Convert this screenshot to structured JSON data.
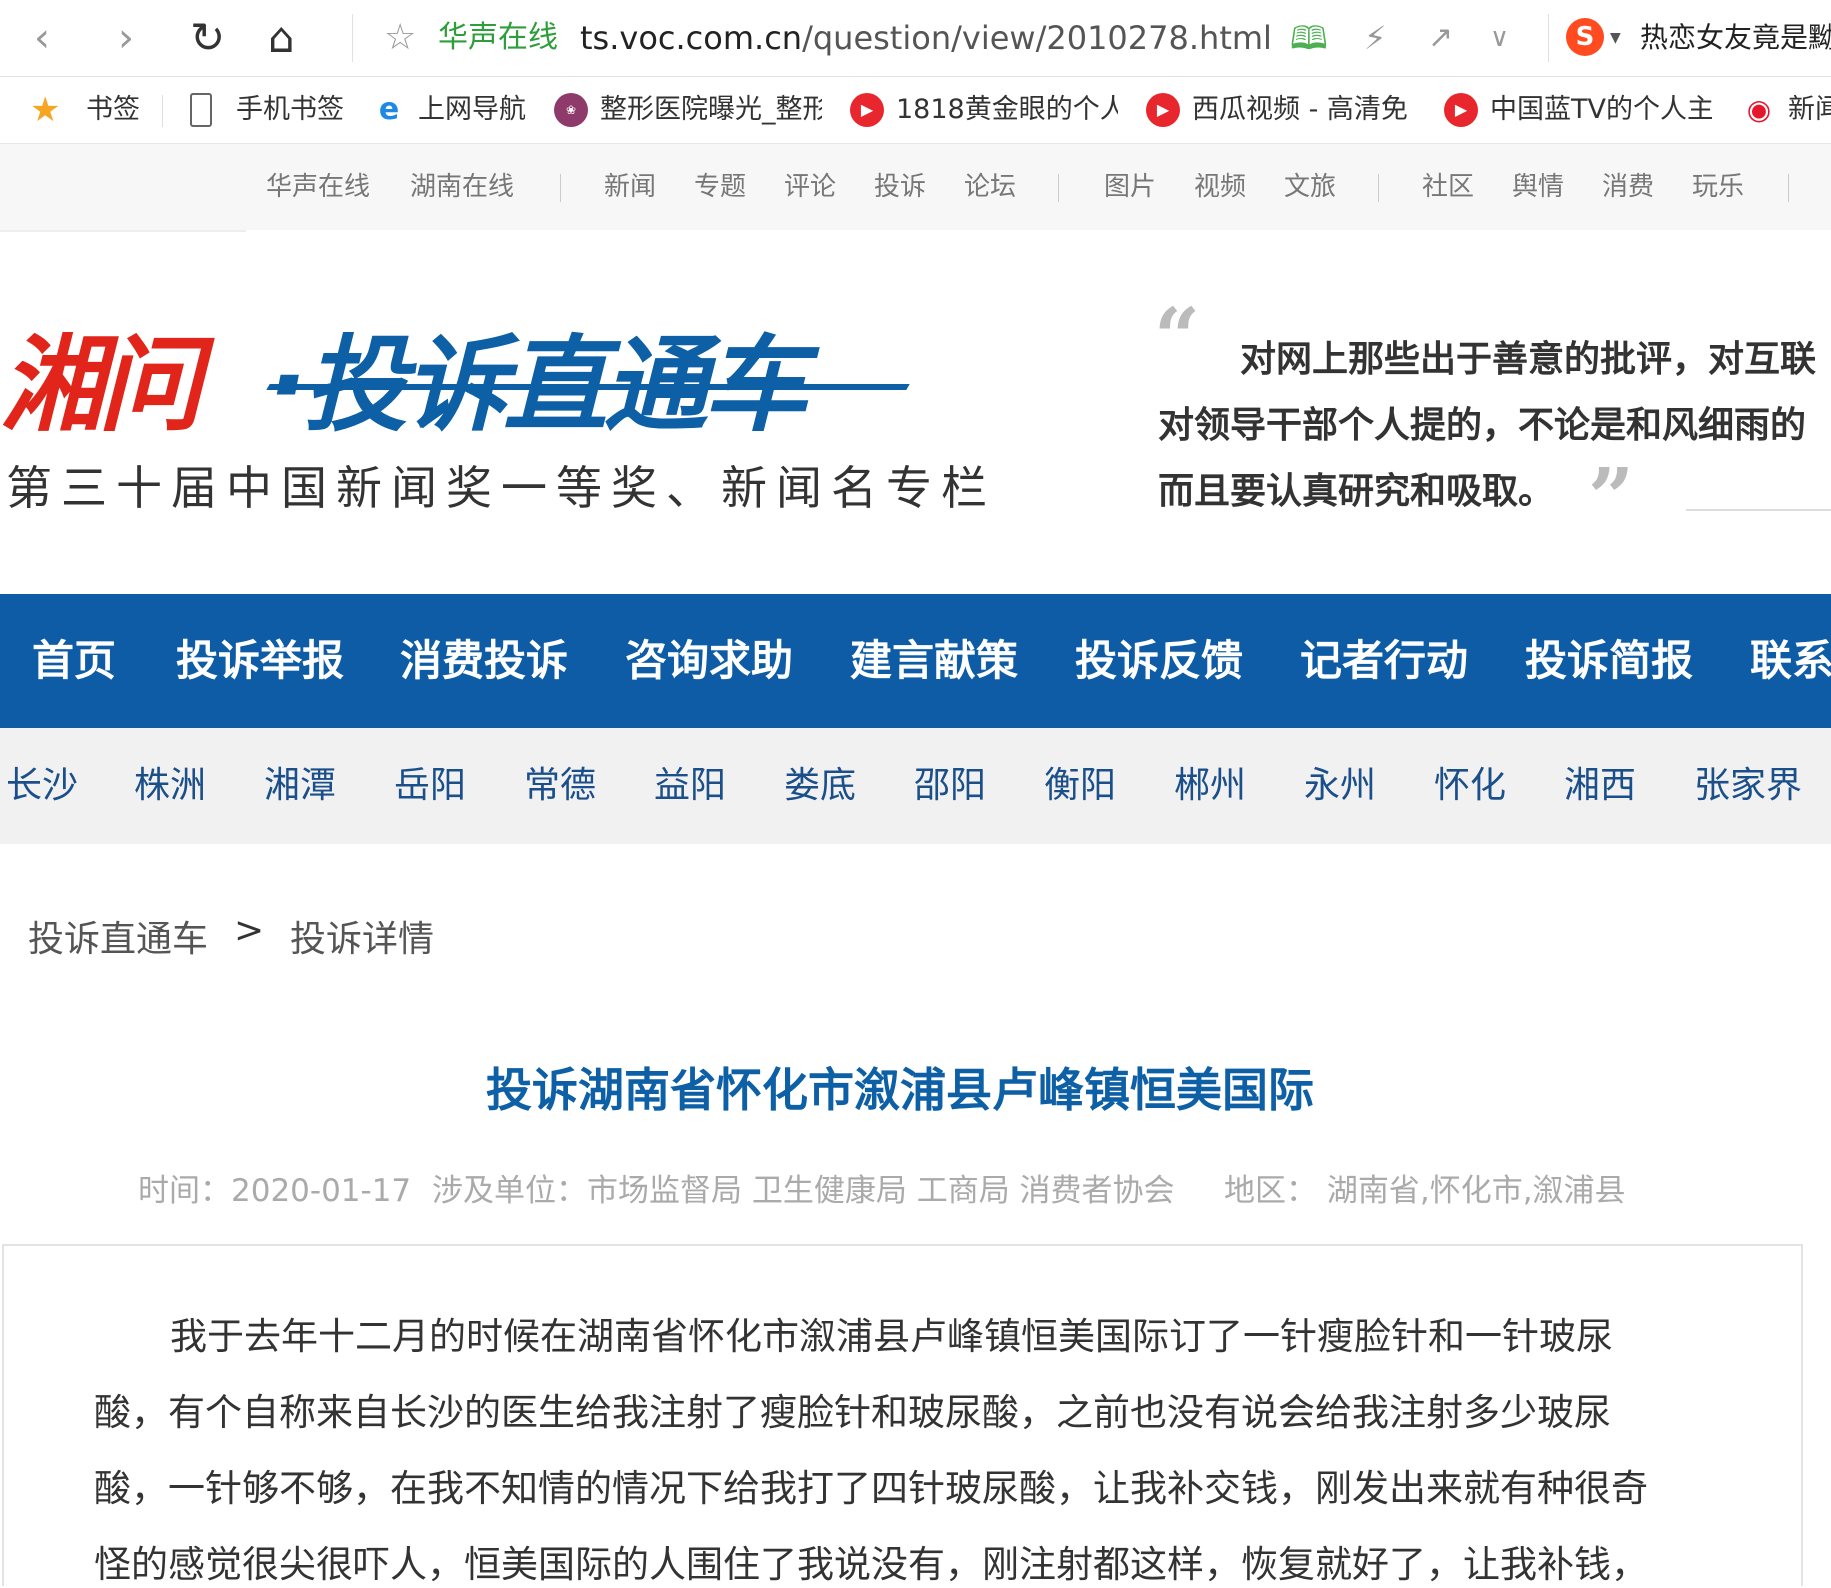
{
  "browser": {
    "url_site": "华声在线",
    "url_domain": "ts.voc.com.cn",
    "url_path": "/question/view/2010278.html",
    "search_text": "热恋女友竟是黝"
  },
  "bookmarks": [
    "书签",
    "手机书签",
    "上网导航",
    "整形医院曝光_整形",
    "1818黄金眼的个人",
    "西瓜视频 - 高清免",
    "中国蓝TV的个人主",
    "新闻"
  ],
  "site_nav": [
    "华声在线",
    "湖南在线",
    "新闻",
    "专题",
    "评论",
    "投诉",
    "论坛",
    "图片",
    "视频",
    "文旅",
    "社区",
    "舆情",
    "消费",
    "玩乐"
  ],
  "header": {
    "logo_red": "湘问",
    "logo_blue": "·投诉直通车",
    "logo_sub": "第三十届中国新闻奖一等奖、新闻名专栏",
    "quote_lines": [
      "对网上那些出于善意的批评，对互联",
      "对领导干部个人提的，不论是和风细雨的",
      "而且要认真研究和吸取。"
    ]
  },
  "main_nav": [
    "首页",
    "投诉举报",
    "消费投诉",
    "咨询求助",
    "建言献策",
    "投诉反馈",
    "记者行动",
    "投诉简报",
    "联系"
  ],
  "region_nav": [
    "长沙",
    "株洲",
    "湘潭",
    "岳阳",
    "常德",
    "益阳",
    "娄底",
    "邵阳",
    "衡阳",
    "郴州",
    "永州",
    "怀化",
    "湘西",
    "张家界"
  ],
  "breadcrumb": {
    "root": "投诉直通车",
    "sep": ">",
    "current": "投诉详情"
  },
  "article": {
    "title": "投诉湖南省怀化市溆浦县卢峰镇恒美国际",
    "time": "时间：2020-01-17",
    "units": "涉及单位：市场监督局 卫生健康局 工商局 消费者协会",
    "region": "地区：   湖南省,怀化市,溆浦县",
    "lines": [
      "我于去年十二月的时候在湖南省怀化市溆浦县卢峰镇恒美国际订了一针瘦脸针和一针玻尿",
      "酸，有个自称来自长沙的医生给我注射了瘦脸针和玻尿酸，之前也没有说会给我注射多少玻尿",
      "酸，一针够不够，在我不知情的情况下给我打了四针玻尿酸，让我补交钱，刚发出来就有种很奇",
      "怪的感觉很尖很吓人，恒美国际的人围住了我说没有，刚注射都这样，恢复就好了，让我补钱，"
    ]
  }
}
